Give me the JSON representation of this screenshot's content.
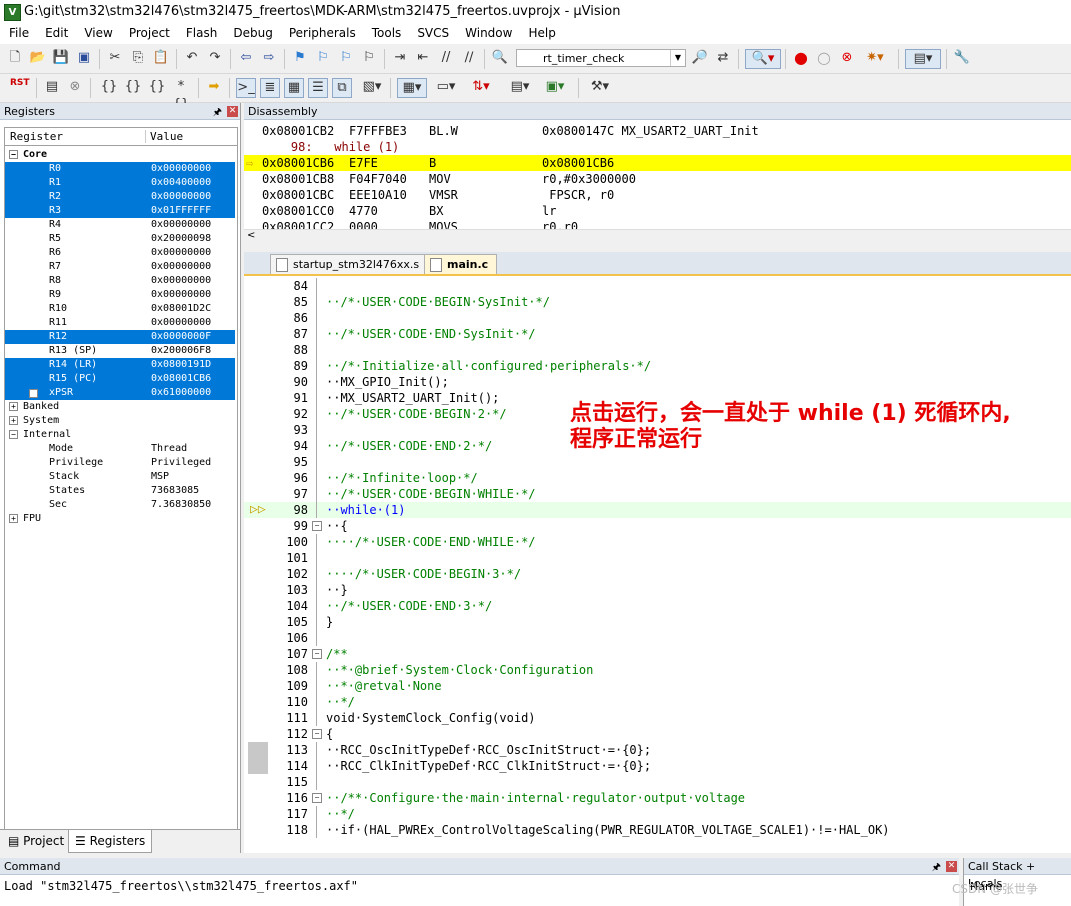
{
  "window": {
    "title": "G:\\git\\stm32\\stm32l476\\stm32l475_freertos\\MDK-ARM\\stm32l475_freertos.uvprojx - µVision"
  },
  "menu": [
    "File",
    "Edit",
    "View",
    "Project",
    "Flash",
    "Debug",
    "Peripherals",
    "Tools",
    "SVCS",
    "Window",
    "Help"
  ],
  "toolbar": {
    "target_combo": "rt_timer_check",
    "rst_label": "RST"
  },
  "registers": {
    "title": "Registers",
    "col_register": "Register",
    "col_value": "Value",
    "core_label": "Core",
    "rows": [
      {
        "name": "R0",
        "value": "0x00000000",
        "selected": true
      },
      {
        "name": "R1",
        "value": "0x00400000",
        "selected": true
      },
      {
        "name": "R2",
        "value": "0x00000000",
        "selected": true
      },
      {
        "name": "R3",
        "value": "0x01FFFFFF",
        "selected": true
      },
      {
        "name": "R4",
        "value": "0x00000000",
        "selected": false
      },
      {
        "name": "R5",
        "value": "0x20000098",
        "selected": false
      },
      {
        "name": "R6",
        "value": "0x00000000",
        "selected": false
      },
      {
        "name": "R7",
        "value": "0x00000000",
        "selected": false
      },
      {
        "name": "R8",
        "value": "0x00000000",
        "selected": false
      },
      {
        "name": "R9",
        "value": "0x00000000",
        "selected": false
      },
      {
        "name": "R10",
        "value": "0x08001D2C",
        "selected": false
      },
      {
        "name": "R11",
        "value": "0x00000000",
        "selected": false
      },
      {
        "name": "R12",
        "value": "0x0000000F",
        "selected": true
      },
      {
        "name": "R13 (SP)",
        "value": "0x200006F8",
        "selected": false
      },
      {
        "name": "R14 (LR)",
        "value": "0x0800191D",
        "selected": true
      },
      {
        "name": "R15 (PC)",
        "value": "0x08001CB6",
        "selected": true
      },
      {
        "name": "xPSR",
        "value": "0x61000000",
        "selected": true
      }
    ],
    "banked_label": "Banked",
    "system_label": "System",
    "internal_label": "Internal",
    "internal_rows": [
      {
        "name": "Mode",
        "value": "Thread"
      },
      {
        "name": "Privilege",
        "value": "Privileged"
      },
      {
        "name": "Stack",
        "value": "MSP"
      },
      {
        "name": "States",
        "value": "73683085"
      },
      {
        "name": "Sec",
        "value": "7.36830850"
      }
    ],
    "fpu_label": "FPU"
  },
  "left_tabs": {
    "project": "Project",
    "registers": "Registers"
  },
  "disassembly": {
    "title": "Disassembly",
    "lines": [
      {
        "addr": "0x08001CB2",
        "code": "F7FFFBE3",
        "mnem": "BL.W",
        "ops": "0x0800147C MX_USART2_UART_Init",
        "current": false
      },
      {
        "src": "    98:   while (1)"
      },
      {
        "addr": "0x08001CB6",
        "code": "E7FE",
        "mnem": "B",
        "ops": "0x08001CB6",
        "current": true
      },
      {
        "addr": "0x08001CB8",
        "code": "F04F7040",
        "mnem": "MOV",
        "ops": "r0,#0x3000000",
        "current": false
      },
      {
        "addr": "0x08001CBC",
        "code": "EEE10A10",
        "mnem": "VMSR",
        "ops": " FPSCR, r0",
        "current": false
      },
      {
        "addr": "0x08001CC0",
        "code": "4770",
        "mnem": "BX",
        "ops": "lr",
        "current": false
      },
      {
        "addr": "0x08001CC2",
        "code": "0000",
        "mnem": "MOVS",
        "ops": "r0,r0",
        "current": false
      }
    ]
  },
  "editor": {
    "tabs": [
      "startup_stm32l476xx.s",
      "main.c"
    ],
    "active_tab": "main.c",
    "lines": [
      {
        "n": "84",
        "t": ""
      },
      {
        "n": "85",
        "t": "··/*·USER·CODE·BEGIN·SysInit·*/",
        "c": "cmt"
      },
      {
        "n": "86",
        "t": ""
      },
      {
        "n": "87",
        "t": "··/*·USER·CODE·END·SysInit·*/",
        "c": "cmt"
      },
      {
        "n": "88",
        "t": ""
      },
      {
        "n": "89",
        "t": "··/*·Initialize·all·configured·peripherals·*/",
        "c": "cmt"
      },
      {
        "n": "90",
        "t": "··MX_GPIO_Init();"
      },
      {
        "n": "91",
        "t": "··MX_USART2_UART_Init();"
      },
      {
        "n": "92",
        "t": "··/*·USER·CODE·BEGIN·2·*/",
        "c": "cmt"
      },
      {
        "n": "93",
        "t": ""
      },
      {
        "n": "94",
        "t": "··/*·USER·CODE·END·2·*/",
        "c": "cmt"
      },
      {
        "n": "95",
        "t": ""
      },
      {
        "n": "96",
        "t": "··/*·Infinite·loop·*/",
        "c": "cmt"
      },
      {
        "n": "97",
        "t": "··/*·USER·CODE·BEGIN·WHILE·*/",
        "c": "cmt"
      },
      {
        "n": "98",
        "t": "··while·(1)",
        "c": "kw",
        "cur": true
      },
      {
        "n": "99",
        "t": "··{",
        "fold": "-"
      },
      {
        "n": "100",
        "t": "····/*·USER·CODE·END·WHILE·*/",
        "c": "cmt"
      },
      {
        "n": "101",
        "t": ""
      },
      {
        "n": "102",
        "t": "····/*·USER·CODE·BEGIN·3·*/",
        "c": "cmt"
      },
      {
        "n": "103",
        "t": "··}"
      },
      {
        "n": "104",
        "t": "··/*·USER·CODE·END·3·*/",
        "c": "cmt"
      },
      {
        "n": "105",
        "t": "}"
      },
      {
        "n": "106",
        "t": ""
      },
      {
        "n": "107",
        "t": "/**",
        "c": "cmt",
        "fold": "-"
      },
      {
        "n": "108",
        "t": "··*·@brief·System·Clock·Configuration",
        "c": "cmt"
      },
      {
        "n": "109",
        "t": "··*·@retval·None",
        "c": "cmt"
      },
      {
        "n": "110",
        "t": "··*/",
        "c": "cmt"
      },
      {
        "n": "111",
        "t": "void·SystemClock_Config(void)"
      },
      {
        "n": "112",
        "t": "{",
        "fold": "-"
      },
      {
        "n": "113",
        "t": "··RCC_OscInitTypeDef·RCC_OscInitStruct·=·{0};"
      },
      {
        "n": "114",
        "t": "··RCC_ClkInitTypeDef·RCC_ClkInitStruct·=·{0};"
      },
      {
        "n": "115",
        "t": ""
      },
      {
        "n": "116",
        "t": "··/**·Configure·the·main·internal·regulator·output·voltage",
        "c": "cmt",
        "fold": "-"
      },
      {
        "n": "117",
        "t": "··*/",
        "c": "cmt"
      },
      {
        "n": "118",
        "t": "··if·(HAL_PWREx_ControlVoltageScaling(PWR_REGULATOR_VOLTAGE_SCALE1)·!=·HAL_OK)"
      }
    ],
    "annotation_line1": "点击运行，会一直处于 while (1) 死循环内,",
    "annotation_line2": "程序正常运行"
  },
  "command": {
    "title": "Command",
    "text": "Load \"stm32l475_freertos\\\\stm32l475_freertos.axf\""
  },
  "callstack": {
    "title": "Call Stack + Locals",
    "col_name": "Name"
  },
  "watermark": "CSDN @张世争"
}
